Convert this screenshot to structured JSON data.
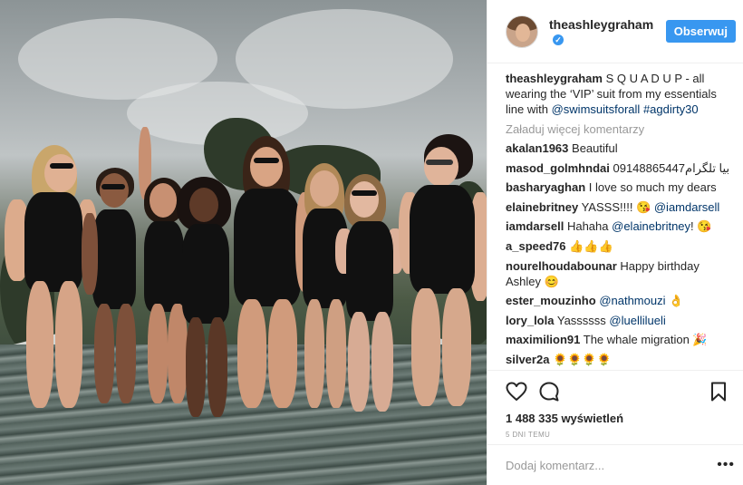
{
  "post": {
    "username": "theashleygraham",
    "verified_mark": "✓",
    "follow_label": "Obserwuj",
    "caption_user": "theashleygraham",
    "caption_text": "S Q U A D U P - all wearing the ‘VIP’ suit from my essentials line with",
    "caption_mention": "@swimsuitsforall",
    "caption_hashtag": "#agdirty30",
    "load_more": "Załaduj więcej komentarzy",
    "views": "1 488 335 wyświetleń",
    "timestamp": "5 DNI TEMU",
    "comment_placeholder": "Dodaj komentarz...",
    "more_dots": "•••"
  },
  "comments": [
    {
      "user": "akalan1963",
      "text": "Beautiful",
      "mention": ""
    },
    {
      "user": "masod_golmhndai",
      "text": "09148865447بیا تلگرام",
      "mention": ""
    },
    {
      "user": "basharyaghan",
      "text": "I love so much my dears",
      "mention": ""
    },
    {
      "user": "elainebritney",
      "text": "YASSS!!!! 😘",
      "mention": "@iamdarsell"
    },
    {
      "user": "iamdarsell",
      "text": "Hahaha",
      "mention": "@elainebritney",
      "suffix": "! 😘"
    },
    {
      "user": "a_speed76",
      "text": "👍👍👍",
      "mention": ""
    },
    {
      "user": "nourelhoudabounar",
      "text": "Happy birthday Ashley 😊",
      "mention": ""
    },
    {
      "user": "ester_mouzinho",
      "text": "",
      "mention": "@nathmouzi",
      "suffix": " 👌"
    },
    {
      "user": "lory_lola",
      "text": "Yassssss",
      "mention": "@luellilueli"
    },
    {
      "user": "maximilion91",
      "text": "The whale migration 🎉",
      "mention": ""
    },
    {
      "user": "silver2a",
      "text": "🌻🌻🌻🌻",
      "mention": ""
    }
  ],
  "icons": {
    "like": "heart-icon",
    "comment": "comment-icon",
    "save": "bookmark-icon",
    "avatar": "avatar"
  }
}
